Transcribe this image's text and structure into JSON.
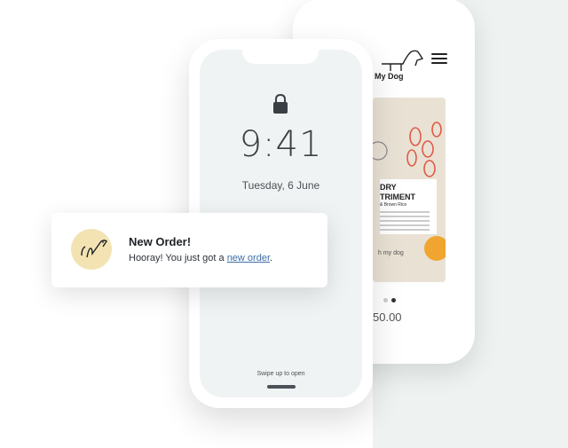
{
  "back_phone": {
    "logo_text": "My Dog",
    "product": {
      "title_line1": "DRY",
      "title_line2": "TRIMENT",
      "subtitle": "& Brown Rice",
      "brand": "h my dog"
    },
    "price": "50.00"
  },
  "lock_screen": {
    "time": "9:41",
    "date": "Tuesday, 6 June",
    "swipe_hint": "Swipe up to open"
  },
  "notification": {
    "title": "New Order!",
    "body_prefix": "Hooray! You just got a ",
    "link_text": "new order",
    "body_suffix": "."
  },
  "colors": {
    "avatar_bg": "#f3e3b3",
    "link": "#3d6da8",
    "accent_orange": "#f0a531",
    "accent_red": "#e05a46"
  },
  "icons": [
    "lock-icon",
    "menu-icon",
    "dog-logo-icon",
    "dog-avatar-icon"
  ]
}
